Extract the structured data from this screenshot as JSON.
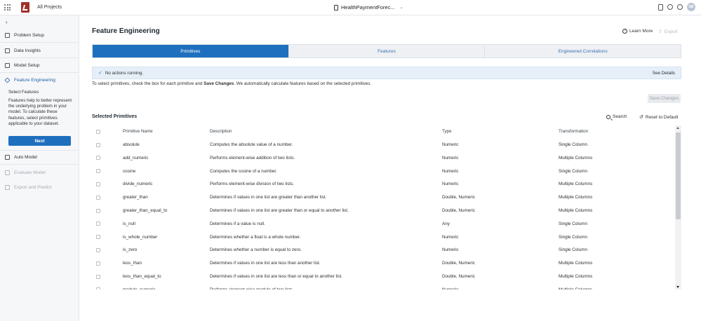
{
  "topbar": {
    "all_projects": "All Projects",
    "project_name": "HealthPaymentForec...",
    "avatar_initials": "SB"
  },
  "sidebar": {
    "items": [
      {
        "label": "Problem Setup",
        "icon": "gear-icon"
      },
      {
        "label": "Data Insights",
        "icon": "chart-icon"
      },
      {
        "label": "Model Setup",
        "icon": "sliders-icon"
      },
      {
        "label": "Feature Engineering",
        "icon": "layers-icon"
      },
      {
        "label": "Auto Model",
        "icon": "cube-icon"
      },
      {
        "label": "Evaluate Model",
        "icon": "monitor-icon"
      },
      {
        "label": "Export and Predict",
        "icon": "download-icon"
      }
    ],
    "sub_title": "Select Features",
    "description": "Features help to better represent the underlying problem in your model. To calculate these features, select primitives applicable to your dataset.",
    "next_label": "Next"
  },
  "main": {
    "title": "Feature Engineering",
    "learn_more": "Learn More",
    "export": "Export",
    "tabs": [
      {
        "label": "Primitives",
        "active": true
      },
      {
        "label": "Features",
        "active": false
      },
      {
        "label": "Engineered Correlations",
        "active": false
      }
    ],
    "status_text": "No actions running.",
    "see_details": "See Details",
    "instructions_pre": "To select primitives, check the box for each primitive and ",
    "instructions_bold": "Save Changes",
    "instructions_post": ". We automatically calculate features based on the selected primitives.",
    "save_changes": "Save Changes",
    "section_title": "Selected Primitives",
    "search": "Search",
    "reset": "Reset to Default",
    "columns": {
      "name": "Primitive Name",
      "description": "Description",
      "type": "Type",
      "transformation": "Transformation"
    },
    "rows": [
      {
        "name": "absolute",
        "description": "Computes the absolute value of a number.",
        "type": "Numeric",
        "transformation": "Single Column"
      },
      {
        "name": "add_numeric",
        "description": "Performs element-wise addition of two lists.",
        "type": "Numeric",
        "transformation": "Multiple Columns"
      },
      {
        "name": "cosine",
        "description": "Computes the cosine of a number.",
        "type": "Numeric",
        "transformation": "Single Column"
      },
      {
        "name": "divide_numeric",
        "description": "Performs element-wise division of two lists.",
        "type": "Numeric",
        "transformation": "Multiple Columns"
      },
      {
        "name": "greater_than",
        "description": "Determines if values in one list are greater than another list.",
        "type": "Double, Numeric",
        "transformation": "Multiple Columns"
      },
      {
        "name": "greater_than_equal_to",
        "description": "Determines if values in one list are greater than or equal to another list.",
        "type": "Double, Numeric",
        "transformation": "Multiple Columns"
      },
      {
        "name": "is_null",
        "description": "Determines if a value is null.",
        "type": "Any",
        "transformation": "Single Column"
      },
      {
        "name": "is_whole_number",
        "description": "Determines whether a float is a whole number.",
        "type": "Numeric",
        "transformation": "Single Column"
      },
      {
        "name": "is_zero",
        "description": "Determines whether a number is equal to zero.",
        "type": "Numeric",
        "transformation": "Single Column"
      },
      {
        "name": "less_than",
        "description": "Determines if values in one list are less than another list.",
        "type": "Double, Numeric",
        "transformation": "Multiple Columns"
      },
      {
        "name": "less_than_equal_to",
        "description": "Determines if values in one list are less than or equal to another list.",
        "type": "Double, Numeric",
        "transformation": "Multiple Columns"
      },
      {
        "name": "modulo_numeric",
        "description": "Performs element-wise modulo of two lists.",
        "type": "Numeric",
        "transformation": "Multiple Columns"
      }
    ]
  }
}
